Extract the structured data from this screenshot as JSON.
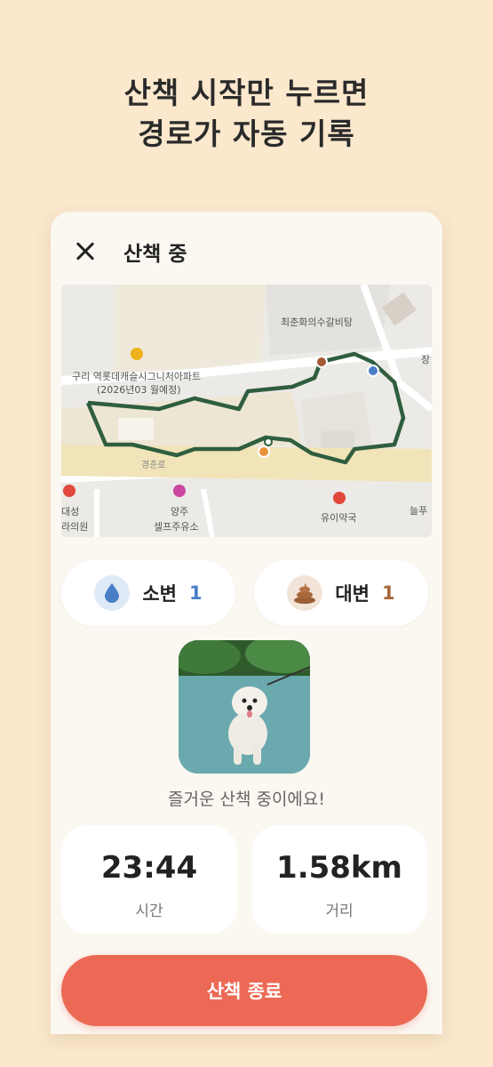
{
  "headline": {
    "line1": "산책 시작만 누르면",
    "line2": "경로가 자동 기록"
  },
  "screen": {
    "title": "산책 중",
    "map": {
      "labels": {
        "apartment": "구리 역롯데캐슬시그니처아파트",
        "apartment_date": "(2026년03 월예정)",
        "market": "최춘화의수갈비탕",
        "edge": "장",
        "road": "경춘로",
        "clinic1": "대성",
        "clinic2": "라의원",
        "station1": "양주",
        "station2": "셀프주유소",
        "pharmacy": "유이약국",
        "east": "늘푸"
      }
    },
    "pee": {
      "label": "소변",
      "count": "1",
      "icon": "water-drop-icon",
      "color": "#4a7fc8"
    },
    "poo": {
      "label": "대변",
      "count": "1",
      "icon": "poop-icon",
      "color": "#a8683a"
    },
    "cheer_message": "즐거운 산책 중이에요!",
    "stats": {
      "time_value": "23:44",
      "time_label": "시간",
      "distance_value": "1.58km",
      "distance_label": "거리"
    },
    "end_button": "산책 종료"
  }
}
